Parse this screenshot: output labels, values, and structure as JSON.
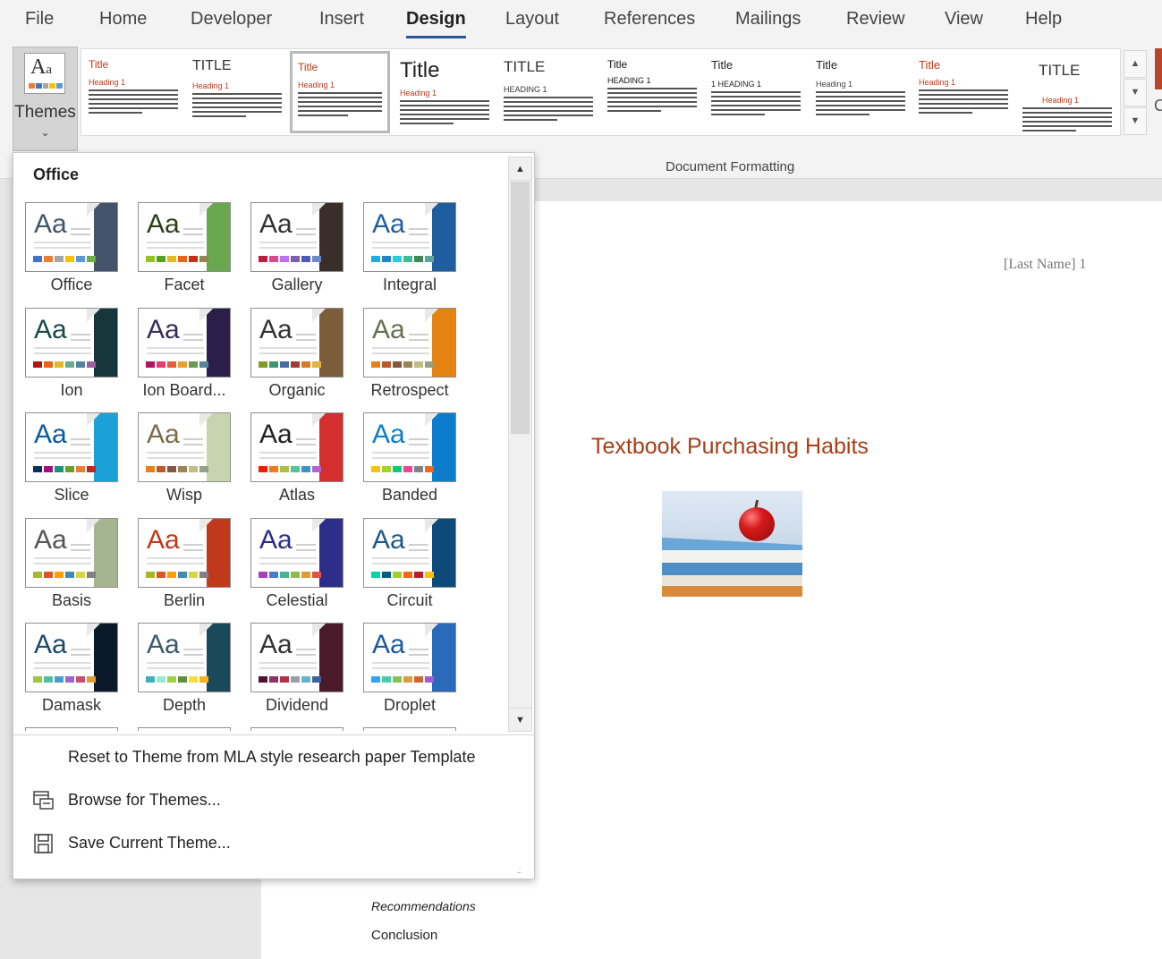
{
  "menu": {
    "tabs": [
      "File",
      "Home",
      "Developer",
      "Insert",
      "Design",
      "Layout",
      "References",
      "Mailings",
      "Review",
      "View",
      "Help"
    ],
    "active": "Design"
  },
  "ribbon": {
    "themes_label": "Themes",
    "group_label": "Document Formatting",
    "styles": [
      {
        "title": "Title",
        "heading": "Heading 1",
        "title_color": "#c0391b",
        "heading_color": "#c0391b"
      },
      {
        "title": "TITLE",
        "heading": "Heading 1",
        "title_color": "#333333",
        "heading_color": "#c0391b"
      },
      {
        "title": "Title",
        "heading": "Heading 1",
        "title_color": "#c0391b",
        "heading_color": "#c0391b"
      },
      {
        "title": "Title",
        "heading": "Heading 1",
        "title_color": "#222222",
        "heading_color": "#c0391b"
      },
      {
        "title": "TITLE",
        "heading": "HEADING 1",
        "title_color": "#333333",
        "heading_color": "#333333"
      },
      {
        "title": "Title",
        "heading": "HEADING 1",
        "title_color": "#111111",
        "heading_color": "#111111"
      },
      {
        "title": "Title",
        "heading": "1 HEADING 1",
        "title_color": "#222222",
        "heading_color": "#222222"
      },
      {
        "title": "Title",
        "heading": "Heading 1",
        "title_color": "#222222",
        "heading_color": "#444444"
      },
      {
        "title": "Title",
        "heading": "Heading 1",
        "title_color": "#c0391b",
        "heading_color": "#c0391b"
      },
      {
        "title": "TITLE",
        "heading": "Heading 1",
        "title_color": "#333333",
        "heading_color": "#c0391b"
      }
    ]
  },
  "dropdown": {
    "header": "Office",
    "themes": [
      {
        "name": "Office",
        "aa_color": "#44546a",
        "accent": "#44546a",
        "swatches": [
          "#4472c4",
          "#ed7d31",
          "#a5a5a5",
          "#ffc000",
          "#5b9bd5",
          "#70ad47"
        ]
      },
      {
        "name": "Facet",
        "aa_color": "#2c3e19",
        "accent": "#6aa84f",
        "swatches": [
          "#90c226",
          "#54a021",
          "#e6b91e",
          "#e76618",
          "#c42f1a",
          "#918655"
        ]
      },
      {
        "name": "Gallery",
        "aa_color": "#333333",
        "accent": "#3a2e2a",
        "swatches": [
          "#b71e42",
          "#de478e",
          "#bc72f0",
          "#795fae",
          "#4d5aba",
          "#6e8ac8"
        ]
      },
      {
        "name": "Integral",
        "aa_color": "#1e5e9e",
        "accent": "#1e5e9e",
        "swatches": [
          "#1cade4",
          "#2683c6",
          "#27ced7",
          "#42ba97",
          "#3e8853",
          "#62a39f"
        ]
      },
      {
        "name": "Ion",
        "aa_color": "#1b4a4a",
        "accent": "#16363c",
        "swatches": [
          "#b01513",
          "#ea6312",
          "#e6b729",
          "#6aac90",
          "#54849a",
          "#9e5e9b"
        ]
      },
      {
        "name": "Ion Board...",
        "aa_color": "#3a2c5a",
        "accent": "#2b1f49",
        "swatches": [
          "#b31166",
          "#e33d6f",
          "#e45f3c",
          "#e9a22f",
          "#689b4d",
          "#54849a"
        ]
      },
      {
        "name": "Organic",
        "aa_color": "#333333",
        "accent": "#7b5d3a",
        "swatches": [
          "#83992a",
          "#3c9770",
          "#44709d",
          "#a23c33",
          "#d97828",
          "#deb340"
        ]
      },
      {
        "name": "Retrospect",
        "aa_color": "#637052",
        "accent": "#e48312",
        "swatches": [
          "#e48312",
          "#bd582c",
          "#865640",
          "#9b8357",
          "#c2bc80",
          "#94a088"
        ]
      },
      {
        "name": "Slice",
        "aa_color": "#0b5aa2",
        "accent": "#1ba1d8",
        "swatches": [
          "#052f61",
          "#a50e82",
          "#14967c",
          "#6a9e1f",
          "#e87d37",
          "#c62324"
        ]
      },
      {
        "name": "Wisp",
        "aa_color": "#7a6d4a",
        "accent": "#c8d3b0",
        "swatches": [
          "#e48312",
          "#bd582c",
          "#865640",
          "#9b8357",
          "#c2bc80",
          "#94a088"
        ]
      },
      {
        "name": "Atlas",
        "aa_color": "#222222",
        "accent": "#d32f2f",
        "swatches": [
          "#f81b02",
          "#fc7715",
          "#afbf41",
          "#50c49f",
          "#3b95c4",
          "#b560d4"
        ]
      },
      {
        "name": "Banded",
        "aa_color": "#0d7ccc",
        "accent": "#0d7ccc",
        "swatches": [
          "#ffc000",
          "#a5d028",
          "#08cc78",
          "#f24099",
          "#828288",
          "#f56617"
        ]
      },
      {
        "name": "Basis",
        "aa_color": "#555555",
        "accent": "#a5b592",
        "swatches": [
          "#a6b727",
          "#df5327",
          "#fe9e00",
          "#418ab3",
          "#d7d447",
          "#818183"
        ]
      },
      {
        "name": "Berlin",
        "aa_color": "#c0391b",
        "accent": "#c0391b",
        "swatches": [
          "#a6b727",
          "#df5327",
          "#fe9e00",
          "#418ab3",
          "#d7d447",
          "#818183"
        ]
      },
      {
        "name": "Celestial",
        "aa_color": "#2d2d8a",
        "accent": "#2d2d8a",
        "swatches": [
          "#ac3ec1",
          "#477bd1",
          "#46b298",
          "#90ba4c",
          "#dd9d31",
          "#e25247"
        ]
      },
      {
        "name": "Circuit",
        "aa_color": "#1c5a8a",
        "accent": "#0d4a7a",
        "swatches": [
          "#03d4a8",
          "#005e7a",
          "#a5d028",
          "#f56617",
          "#bf1a2a",
          "#ffc000"
        ]
      },
      {
        "name": "Damask",
        "aa_color": "#1c4a6a",
        "accent": "#0a1a2a",
        "swatches": [
          "#9ec544",
          "#50bea3",
          "#4a9ccc",
          "#9a66ca",
          "#c54f71",
          "#de9c3c"
        ]
      },
      {
        "name": "Depth",
        "aa_color": "#3a5a6a",
        "accent": "#1a4a5a",
        "swatches": [
          "#41aebd",
          "#97e9d5",
          "#a2cf49",
          "#608f3d",
          "#f4de3a",
          "#fcb11c"
        ]
      },
      {
        "name": "Dividend",
        "aa_color": "#333333",
        "accent": "#4a1a2a",
        "swatches": [
          "#4d1434",
          "#903163",
          "#b2324b",
          "#969fa7",
          "#66b1ce",
          "#40619d"
        ]
      },
      {
        "name": "Droplet",
        "aa_color": "#1a5aa0",
        "accent": "#2a6aba",
        "swatches": [
          "#2fa3ee",
          "#4bcaad",
          "#86c157",
          "#d99c3f",
          "#ce6633",
          "#a35dd1"
        ]
      }
    ],
    "actions": {
      "reset": "Reset to Theme from MLA style research paper Template",
      "browse": "Browse for Themes...",
      "save": "Save Current Theme..."
    }
  },
  "document": {
    "last_name": "[Last Name]  1",
    "title": "Textbook Purchasing Habits",
    "toc_recommendations": "Recommendations",
    "toc_conclusion": "Conclusion"
  }
}
